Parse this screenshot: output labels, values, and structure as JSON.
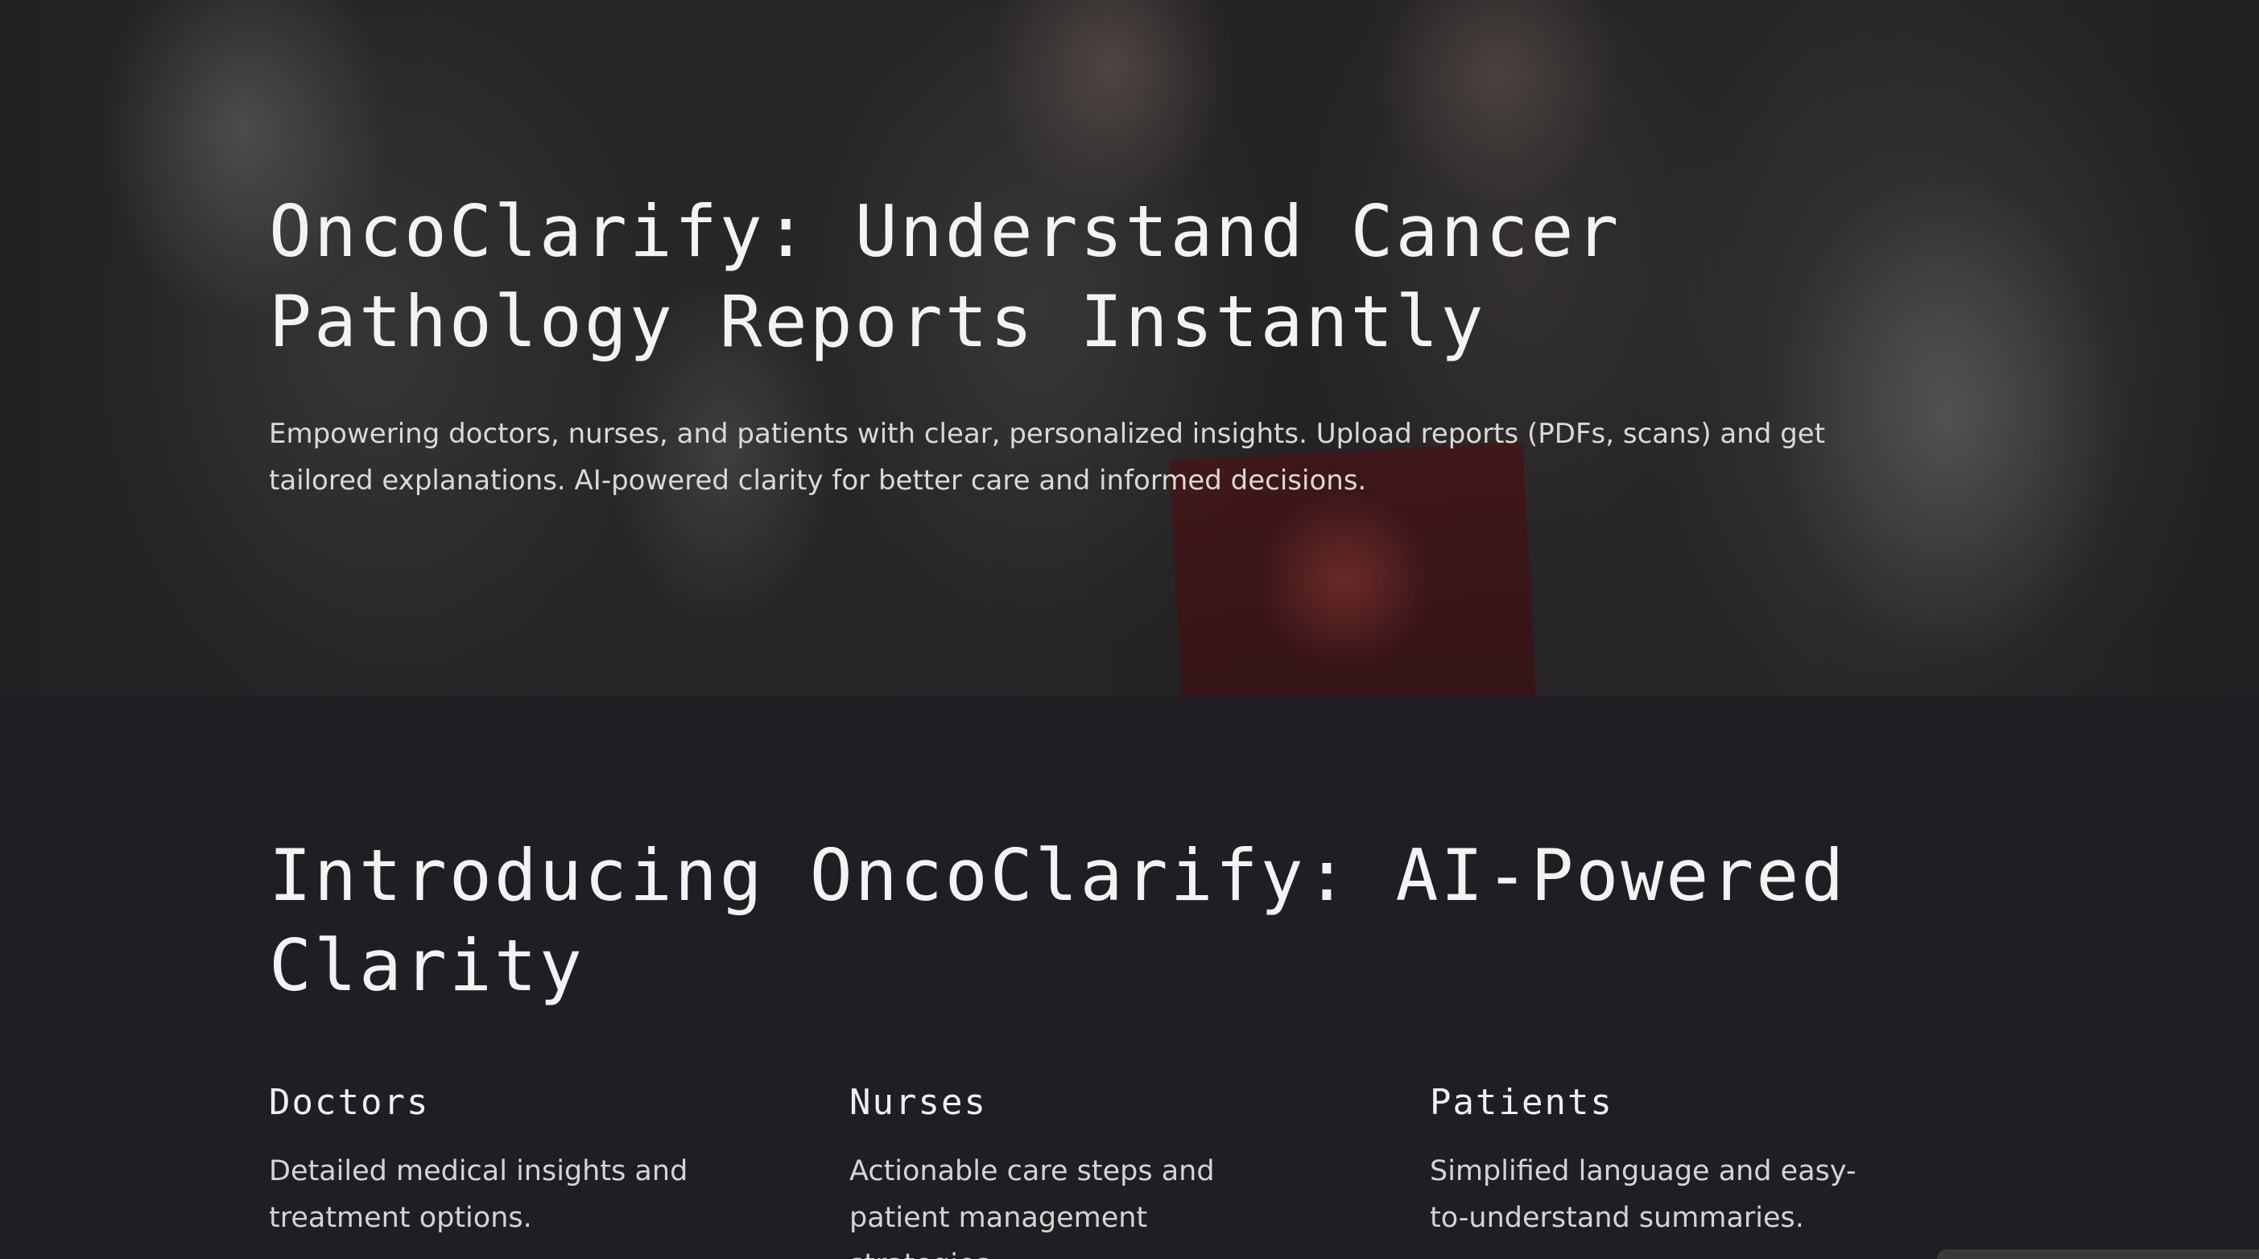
{
  "hero": {
    "title": "OncoClarify: Understand Cancer Pathology Reports Instantly",
    "subtitle": "Empowering doctors, nurses, and patients with clear, personalized insights. Upload reports (PDFs, scans) and get tailored explanations. AI-powered clarity for better care and informed decisions."
  },
  "intro": {
    "title": "Introducing OncoClarify: AI-Powered Clarity",
    "cards": [
      {
        "title": "Doctors",
        "text": "Detailed medical insights and treatment options."
      },
      {
        "title": "Nurses",
        "text": "Actionable care steps and patient management strategies."
      },
      {
        "title": "Patients",
        "text": "Simplified language and easy-to-understand summaries."
      }
    ]
  },
  "colors": {
    "background": "#201e24",
    "heading": "#f4f2f2",
    "body_text": "#dcd8d8"
  }
}
